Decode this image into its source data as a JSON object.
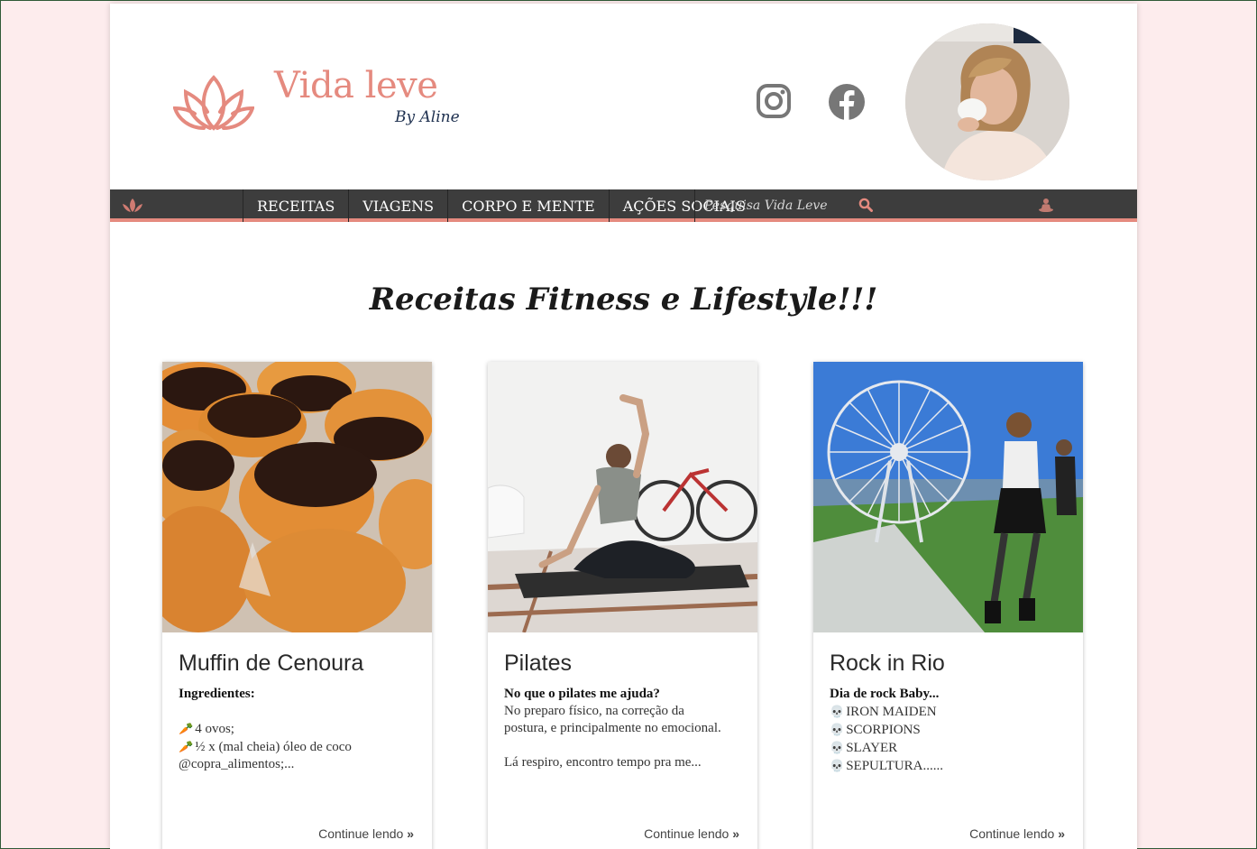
{
  "header": {
    "logo_title": "Vida leve",
    "logo_subtitle": "By Aline",
    "social": [
      "instagram-icon",
      "facebook-icon"
    ]
  },
  "nav": {
    "items": [
      "RECEITAS",
      "VIAGENS",
      "CORPO E MENTE",
      "AÇÕES SOCIAIS"
    ],
    "search_placeholder": "Pesquisa Vida Leve"
  },
  "main": {
    "heading": "Receitas Fitness e Lifestyle!!!",
    "cards": [
      {
        "title": "Muffin de Cenoura",
        "lead": "Ingredientes:",
        "lines": [
          "4 ovos;",
          "½ x (mal cheia) óleo de coco",
          "@copra_alimentos;..."
        ],
        "more": "Continue lendo"
      },
      {
        "title": "Pilates",
        "lead": "No que o pilates me ajuda?",
        "lines": [
          "No preparo físico, na correção da",
          "postura, e principalmente no emocional.",
          "Lá respiro, encontro tempo pra me..."
        ],
        "more": "Continue lendo"
      },
      {
        "title": "Rock in Rio",
        "lead": "Dia de rock Baby...",
        "lines": [
          "IRON MAIDEN",
          "SCORPIONS",
          "SLAYER",
          "SEPULTURA......"
        ],
        "more": "Continue lendo"
      }
    ]
  },
  "colors": {
    "accent": "#e58a7f",
    "nav_bg": "#3d3d3d",
    "page_bg": "#fdeced"
  }
}
